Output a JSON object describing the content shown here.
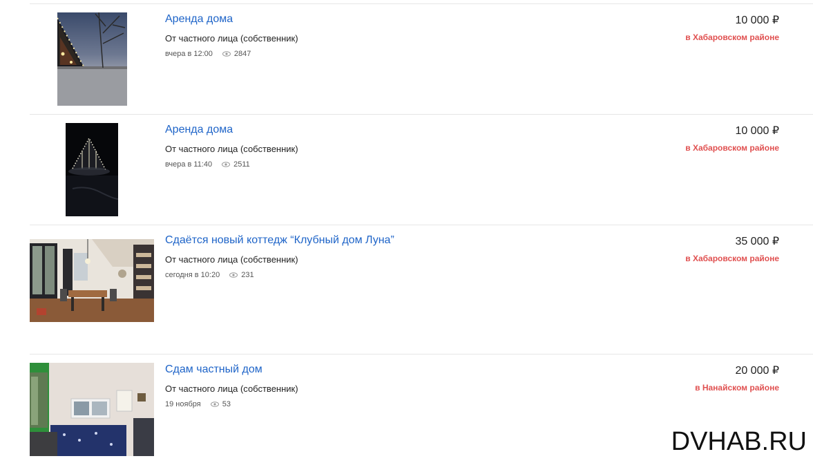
{
  "listings": [
    {
      "title": "Аренда дома",
      "seller": "От частного лица (собственник)",
      "date": "вчера в 12:00",
      "views": "2847",
      "price": "10 000 ₽",
      "region": "в Хабаровском районе"
    },
    {
      "title": "Аренда дома",
      "seller": "От частного лица (собственник)",
      "date": "вчера в 11:40",
      "views": "2511",
      "price": "10 000 ₽",
      "region": "в Хабаровском районе"
    },
    {
      "title": "Сдаётся новый коттедж “Клубный дом Луна”",
      "seller": "От частного лица (собственник)",
      "date": "сегодня в 10:20",
      "views": "231",
      "price": "35 000 ₽",
      "region": "в Хабаровском районе"
    },
    {
      "title": "Сдам частный дом",
      "seller": "От частного лица (собственник)",
      "date": "19 ноября",
      "views": "53",
      "price": "20 000 ₽",
      "region": "в Нанайском районе"
    }
  ],
  "watermark": "DVHAB.RU",
  "colors": {
    "link": "#1e64c8",
    "region": "#e05050",
    "separator": "#e6e6e6"
  },
  "icons": {
    "views": "eye-icon"
  }
}
